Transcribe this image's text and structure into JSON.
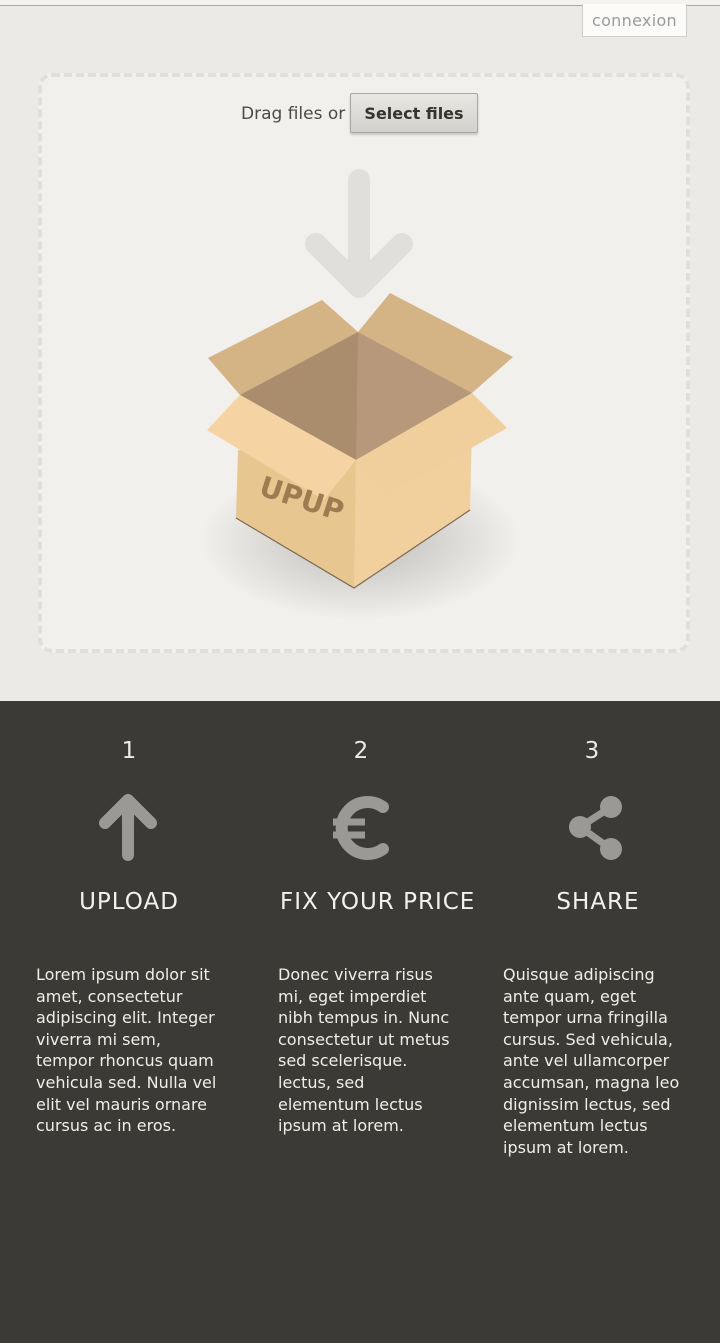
{
  "header": {
    "login_label": "connexion"
  },
  "dropzone": {
    "prompt": "Drag files or",
    "select_button": "Select files",
    "box_brand": "UPUP"
  },
  "steps": [
    {
      "number": "1",
      "icon": "upload-arrow-icon",
      "title": "UPLOAD",
      "text": "Lorem ipsum dolor sit amet, consectetur adipiscing elit. Integer viverra mi sem, tempor rhoncus quam vehicula sed. Nulla vel elit vel mauris ornare cursus ac in eros."
    },
    {
      "number": "2",
      "icon": "euro-icon",
      "title": "FIX YOUR PRICE",
      "text": "Donec viverra risus mi, eget imperdiet nibh tempus in. Nunc consectetur ut metus sed scelerisque. lectus, sed elementum lectus ipsum at lorem."
    },
    {
      "number": "3",
      "icon": "share-icon",
      "title": "SHARE",
      "text": "Quisque adipiscing ante quam, eget tempor urna fringilla cursus. Sed vehicula, ante vel ullamcorper accumsan, magna leo dignissim lectus, sed elementum lectus ipsum at lorem."
    }
  ],
  "colors": {
    "page_background": "#ebeae6",
    "steps_background": "#3b3a36",
    "icon_gray": "#9a9995",
    "box_light": "#f1cf9e",
    "box_mid": "#d6b385",
    "box_dark": "#a88d6d"
  }
}
